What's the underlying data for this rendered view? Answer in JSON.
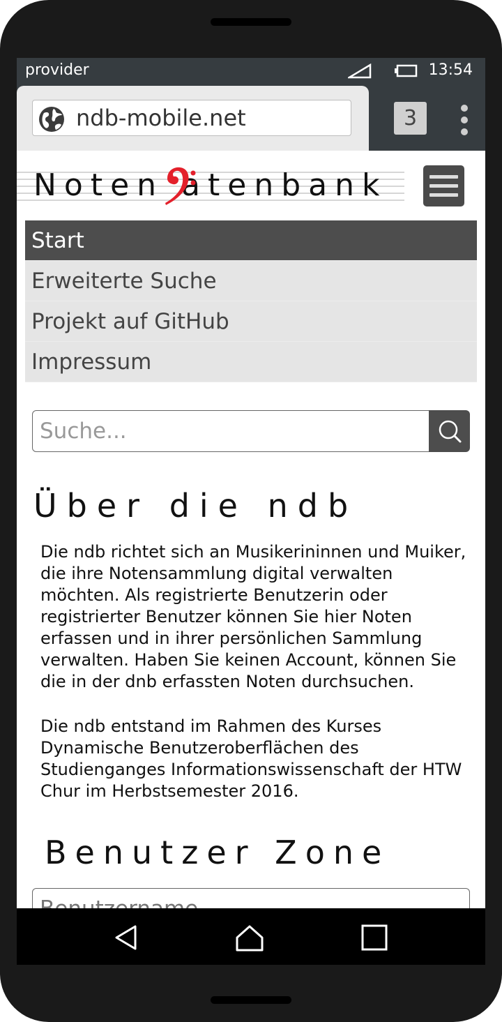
{
  "status_bar": {
    "provider": "provider",
    "time": "13:54"
  },
  "browser": {
    "url": "ndb-mobile.net",
    "tab_count": "3"
  },
  "site": {
    "logo_text": "Noten  atenbank"
  },
  "nav": {
    "items": [
      {
        "label": "Start",
        "active": true
      },
      {
        "label": "Erweiterte Suche",
        "active": false
      },
      {
        "label": "Projekt auf GitHub",
        "active": false
      },
      {
        "label": "Impressum",
        "active": false
      }
    ]
  },
  "search": {
    "placeholder": "Suche..."
  },
  "about": {
    "title": "Über die ndb",
    "paragraph1": "Die ndb richtet sich an Musikerininnen und Muiker, die ihre Notensammlung digital verwalten möchten. Als registrierte Benutzerin oder registrierter Benutzer können Sie hier Noten erfassen und in ihrer persönlichen Sammlung verwalten. Haben Sie keinen Account, können Sie die in der dnb erfassten Noten durchsuchen.",
    "paragraph2": "Die ndb entstand im Rahmen des Kurses Dynamische Benutzeroberflächen des Studienganges Informationswissenschaft der HTW Chur im Herbstsemester 2016."
  },
  "user_zone": {
    "title": "Benutzer Zone",
    "username_placeholder": "Benutzername"
  },
  "colors": {
    "clef_red": "#e3202b",
    "nav_active": "#4d4d4d",
    "nav_bg": "#e5e5e5",
    "chrome": "#363c40"
  }
}
